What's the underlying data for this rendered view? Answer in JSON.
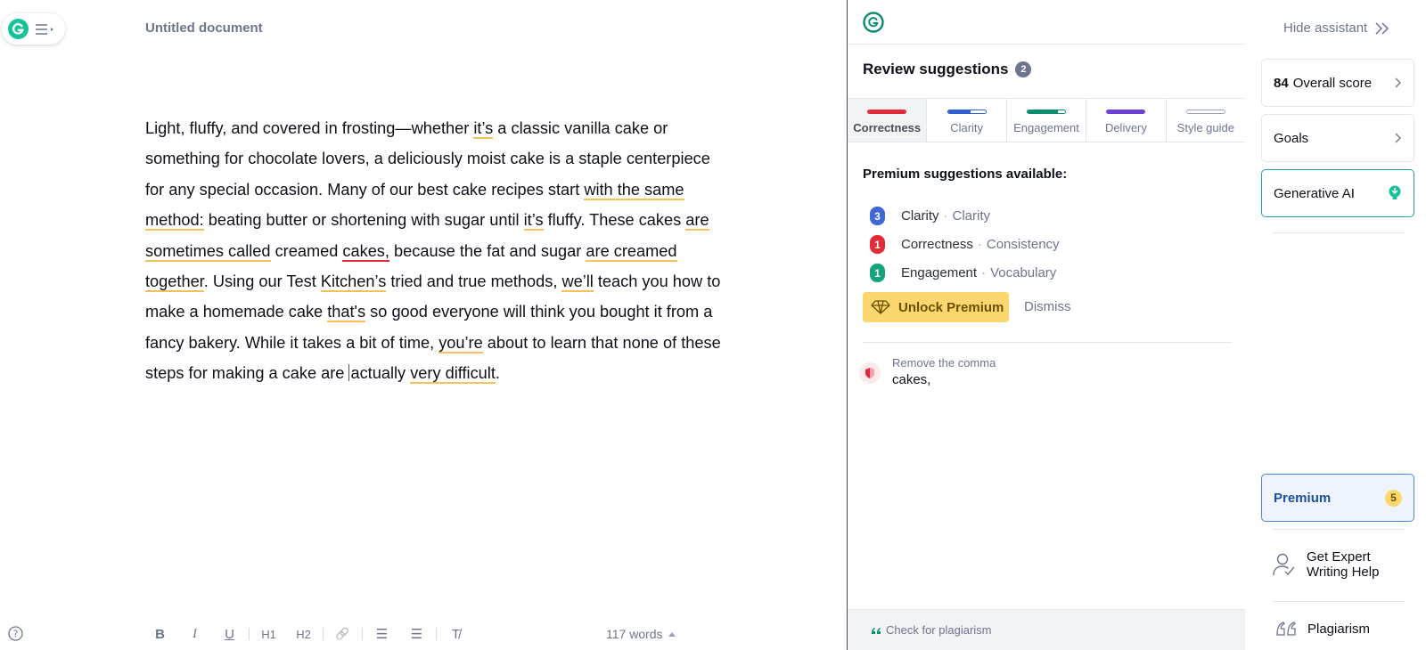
{
  "colors": {
    "accent": "#15c39a",
    "correctness": "#e22a39",
    "clarity": "#2f5fd0",
    "engagement": "#0a8f6c",
    "delivery": "#6a3fd1",
    "style_guide": "#9aa0b0",
    "premium_gold": "#fbd76d",
    "underline_yellow": "#f6c15b"
  },
  "editor": {
    "title": "Untitled document",
    "paragraph": [
      {
        "t": "Light, fluffy, and covered in frosting—whether "
      },
      {
        "t": "it’s",
        "u": "y"
      },
      {
        "t": " a classic vanilla cake or something for chocolate lovers, a deliciously moist cake is a staple centerpiece for any special occasion. Many of our best cake recipes start "
      },
      {
        "t": "with the same method:",
        "u": "y"
      },
      {
        "t": " beating butter or shortening with sugar until "
      },
      {
        "t": "it’s",
        "u": "y"
      },
      {
        "t": " fluffy. These cakes "
      },
      {
        "t": "are sometimes called",
        "u": "y"
      },
      {
        "t": " creamed "
      },
      {
        "t": "cakes,",
        "u": "r"
      },
      {
        "t": " because the fat and sugar "
      },
      {
        "t": "are creamed together",
        "u": "y"
      },
      {
        "t": ". Using our Test "
      },
      {
        "t": "Kitchen’s",
        "u": "y"
      },
      {
        "t": " tried and true methods, "
      },
      {
        "t": "we’ll",
        "u": "y"
      },
      {
        "t": " teach you how to make a homemade cake "
      },
      {
        "t": "that's",
        "u": "y"
      },
      {
        "t": " so good everyone will think you bought it from a fancy bakery. While it takes a bit of time, "
      },
      {
        "t": "you’re",
        "u": "y"
      },
      {
        "t": " about to learn that none of these steps for making a cake are "
      },
      {
        "t": "",
        "caret": true
      },
      {
        "t": "actually "
      },
      {
        "t": "very difficult",
        "u": "y"
      },
      {
        "t": "."
      }
    ],
    "toolbar": [
      {
        "name": "bold-button",
        "glyph": "B",
        "icon": "bold-icon"
      },
      {
        "name": "italic-button",
        "glyph": "I",
        "icon": "italic-icon"
      },
      {
        "name": "underline-button",
        "glyph": "U",
        "icon": "underline-icon"
      },
      {
        "sep": true
      },
      {
        "name": "heading1-button",
        "glyph": "H1",
        "icon": "heading1-icon"
      },
      {
        "name": "heading2-button",
        "glyph": "H2",
        "icon": "heading2-icon"
      },
      {
        "sep": true
      },
      {
        "name": "link-button",
        "glyph": "🔗",
        "icon": "link-icon"
      },
      {
        "sep": true
      },
      {
        "name": "numbered-list-button",
        "glyph": "☰",
        "icon": "numbered-list-icon"
      },
      {
        "name": "bulleted-list-button",
        "glyph": "☰",
        "icon": "bulleted-list-icon"
      },
      {
        "sep": true
      },
      {
        "name": "clear-format-button",
        "glyph": "T̸",
        "icon": "clear-format-icon"
      }
    ],
    "word_count": "117 words"
  },
  "review": {
    "title": "Review suggestions",
    "count": "2",
    "tabs": [
      {
        "label": "Correctness",
        "color": "#e22a39",
        "fill": 1.0,
        "active": true
      },
      {
        "label": "Clarity",
        "color": "#2f5fd0",
        "fill": 0.6,
        "active": false
      },
      {
        "label": "Engagement",
        "color": "#0a8f6c",
        "fill": 0.8,
        "active": false
      },
      {
        "label": "Delivery",
        "color": "#6a3fd1",
        "fill": 1.0,
        "active": false
      },
      {
        "label": "Style guide",
        "color": "#ffffff",
        "fill": 1.0,
        "active": false
      }
    ],
    "premium_heading": "Premium suggestions available:",
    "premium_items": [
      {
        "count": "3",
        "category": "Clarity",
        "sub": "Clarity",
        "color": "#3f67d8"
      },
      {
        "count": "1",
        "category": "Correctness",
        "sub": "Consistency",
        "color": "#e22a39"
      },
      {
        "count": "1",
        "category": "Engagement",
        "sub": "Vocabulary",
        "color": "#14a57e"
      }
    ],
    "unlock_label": "Unlock Premium",
    "dismiss_label": "Dismiss",
    "card": {
      "title": "Remove the comma",
      "word": "cakes,"
    },
    "plagiarism_footer": "Check for plagiarism"
  },
  "sidebar": {
    "hide_label": "Hide assistant",
    "score_value": "84",
    "score_label": "Overall score",
    "goals_label": "Goals",
    "genai_label": "Generative AI",
    "premium_label": "Premium",
    "premium_count": "5",
    "expert_label": "Get Expert Writing Help",
    "plagiarism_label": "Plagiarism"
  }
}
